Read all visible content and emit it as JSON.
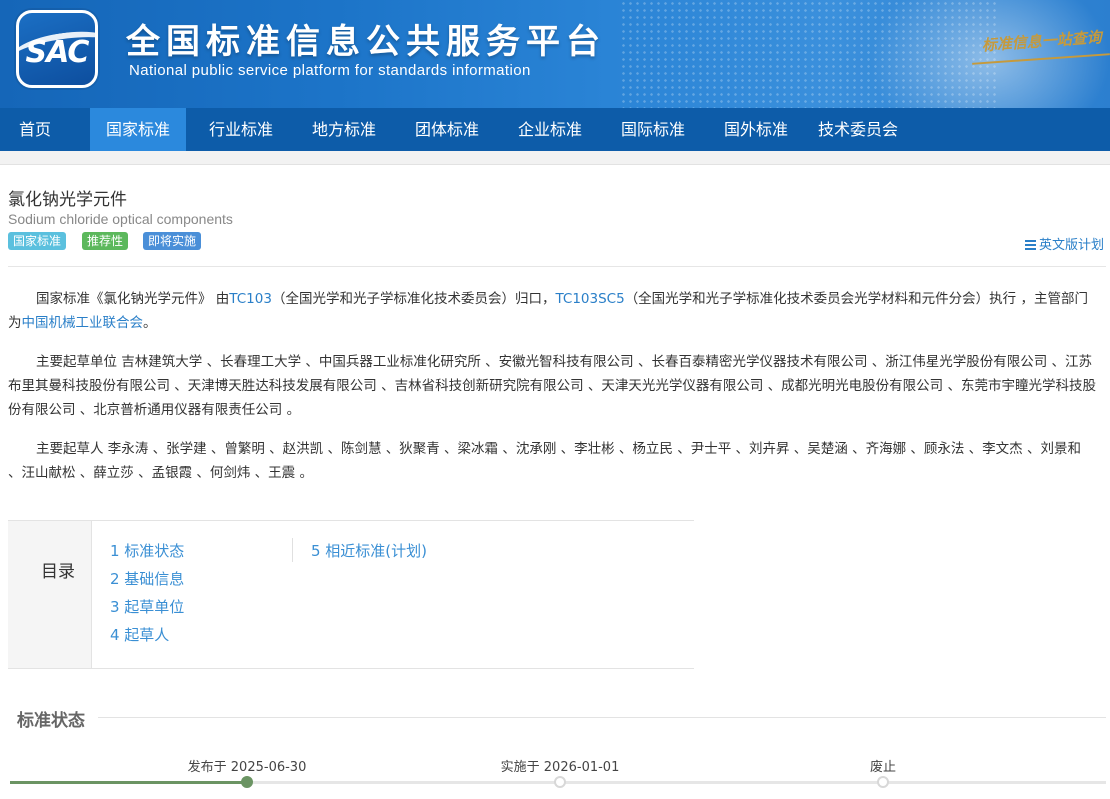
{
  "header": {
    "logo_text": "SAC",
    "site_title_cn": "全国标准信息公共服务平台",
    "site_title_en": "National public service platform  for standards information",
    "slogan": "标准信息一站查询"
  },
  "nav": {
    "items": [
      {
        "label": "首页"
      },
      {
        "label": "国家标准"
      },
      {
        "label": "行业标准"
      },
      {
        "label": "地方标准"
      },
      {
        "label": "团体标准"
      },
      {
        "label": "企业标准"
      },
      {
        "label": "国际标准"
      },
      {
        "label": "国外标准"
      },
      {
        "label": "技术委员会"
      }
    ],
    "active_index": 1
  },
  "standard": {
    "title_cn": "氯化钠光学元件",
    "title_en": "Sodium chloride optical components",
    "badges": [
      {
        "label": "国家标准",
        "color": "#5bc0de"
      },
      {
        "label": "推荐性",
        "color": "#5cb85c"
      },
      {
        "label": "即将实施",
        "color": "#4a8fd8"
      }
    ],
    "english_plan_link": "英文版计划"
  },
  "intro": {
    "p1_prefix": "国家标准《氯化钠光学元件》 由",
    "tc_code": "TC103",
    "tc_name": "（全国光学和光子学标准化技术委员会）归口，",
    "sc_code": "TC103SC5",
    "sc_name": "（全国光学和光子学标准化技术委员会光学材料和元件分会）执行 ，主管部门为",
    "dept": "中国机械工业联合会",
    "p1_suffix": "。",
    "p2": "主要起草单位 吉林建筑大学 、长春理工大学 、中国兵器工业标准化研究所 、安徽光智科技有限公司 、长春百泰精密光学仪器技术有限公司 、浙江伟星光学股份有限公司 、江苏布里其曼科技股份有限公司 、天津博天胜达科技发展有限公司 、吉林省科技创新研究院有限公司 、天津天光光学仪器有限公司 、成都光明光电股份有限公司 、东莞市宇瞳光学科技股份有限公司 、北京普析通用仪器有限责任公司 。",
    "p3": "主要起草人 李永涛 、张学建 、曾繁明 、赵洪凯 、陈剑慧 、狄聚青 、梁冰霜 、沈承刚 、李壮彬 、杨立民 、尹士平 、刘卉昇 、吴楚涵 、齐海娜 、顾永法 、李文杰 、刘景和 、汪山献松 、薛立莎 、孟银霞 、何剑炜 、王震 。"
  },
  "toc": {
    "label": "目录",
    "items": [
      {
        "label": "1  标准状态"
      },
      {
        "label": "2  基础信息"
      },
      {
        "label": "3  起草单位"
      },
      {
        "label": "4  起草人"
      },
      {
        "label": "5  相近标准(计划)"
      }
    ]
  },
  "status_section": {
    "title": "标准状态",
    "timeline": [
      {
        "label": "发布于 2025-06-30",
        "done": true
      },
      {
        "label": "实施于 2026-01-01",
        "done": false
      },
      {
        "label": "废止",
        "done": false
      }
    ]
  }
}
